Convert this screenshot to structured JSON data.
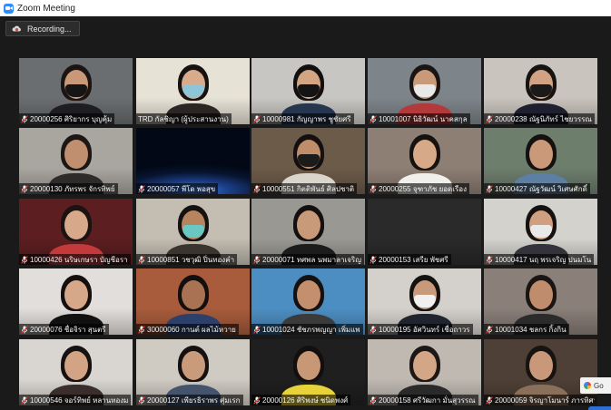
{
  "window": {
    "title": "Zoom Meeting",
    "icon": "zoom-icon"
  },
  "recording": {
    "label": "Recording...",
    "icon": "cloud-recording-icon"
  },
  "participants": [
    {
      "name": "20000256 ศิริยากร บุญคุ้ม",
      "muted": true,
      "active": false,
      "bg": "#6b6e70",
      "skin": "#c99878",
      "hair": "#1b1412",
      "shirt": "#1d1d22",
      "mask": "#151515"
    },
    {
      "name": "TRD กัลชิญา (ผู้ประสานงาน)",
      "muted": false,
      "active": true,
      "bg": "#e7e2d6",
      "skin": "#d8ab8c",
      "hair": "#171210",
      "shirt": "#2b2624",
      "mask": "#8fc5d8"
    },
    {
      "name": "10000981 กัญญาพร ชูชัยศรี",
      "muted": true,
      "active": false,
      "bg": "#c8c6c2",
      "skin": "#d3a582",
      "hair": "#120f0e",
      "shirt": "#27364f",
      "mask": "#141414"
    },
    {
      "name": "10001007 นิธิวัฒน์ นาคสกุล",
      "muted": true,
      "active": false,
      "bg": "#7e858a",
      "skin": "#c89a79",
      "hair": "#1a1512",
      "shirt": "#b33a3a",
      "mask": "#e8e8e8"
    },
    {
      "name": "20000238 ณัฐนิภัทร์ ไชยวรรณ",
      "muted": true,
      "active": false,
      "bg": "#c9c4bd",
      "skin": "#d1a283",
      "hair": "#171311",
      "shirt": "#1e2030",
      "mask": "#1a1a1a"
    },
    {
      "name": "20000130 ภัทรพร จักรทิพย์",
      "muted": true,
      "active": false,
      "bg": "#a9a6a0",
      "skin": "#c08f70",
      "hair": "#1c1614",
      "shirt": "#2f2b2a",
      "mask": ""
    },
    {
      "name": "20000057 พีโด พอสุข",
      "muted": true,
      "active": false,
      "bg": "#0b1836",
      "skin": "",
      "hair": "",
      "shirt": "",
      "mask": ""
    },
    {
      "name": "10000551 กิตติพันธ์ ศิลปชาติ",
      "muted": true,
      "active": false,
      "bg": "#6d5b49",
      "skin": "#bf8d6a",
      "hair": "#141010",
      "shirt": "#d9d4cc",
      "mask": "#1b1b1b"
    },
    {
      "name": "20000255 จุฑาภัช ยอดเรือง",
      "muted": true,
      "active": false,
      "bg": "#8e7f74",
      "skin": "#d7a988",
      "hair": "#161210",
      "shirt": "#f0efec",
      "mask": ""
    },
    {
      "name": "10000427 ณัฐวัฒน์ วิเศษศักดิ์",
      "muted": true,
      "active": false,
      "bg": "#6e7e6d",
      "skin": "#c99979",
      "hair": "#151110",
      "shirt": "#5d7fa3",
      "mask": ""
    },
    {
      "name": "10000426 นริษเกษรา บัญชีอรา",
      "muted": true,
      "active": false,
      "bg": "#5c1e20",
      "skin": "#d7a88a",
      "hair": "#1a1311",
      "shirt": "#c43a3a",
      "mask": ""
    },
    {
      "name": "10000851 วชวุฒิ ปิ่นทองคำ",
      "muted": true,
      "active": false,
      "bg": "#c3bdb2",
      "skin": "#b7845f",
      "hair": "#141110",
      "shirt": "#3a342e",
      "mask": "#69c9c2"
    },
    {
      "name": "20000071 ทศพล นพมาลาเจริญ",
      "muted": true,
      "active": false,
      "bg": "#9a9893",
      "skin": "#c99a7a",
      "hair": "#141010",
      "shirt": "#1c1c1c",
      "mask": ""
    },
    {
      "name": "20000153 เสรีย พัชศรี",
      "muted": true,
      "active": false,
      "bg": "#2a2a2a",
      "skin": "",
      "hair": "",
      "shirt": "",
      "mask": ""
    },
    {
      "name": "10000417 นฤ พรเจริญ ปนมโน",
      "muted": true,
      "active": false,
      "bg": "#d3d2cd",
      "skin": "#cf9f7f",
      "hair": "#151111",
      "shirt": "#34323a",
      "mask": "#e9e9e9"
    },
    {
      "name": "20000076 ชื่อจิรา สุนตรี",
      "muted": true,
      "active": false,
      "bg": "#e2dedb",
      "skin": "#d6a789",
      "hair": "#141010",
      "shirt": "#111111",
      "mask": ""
    },
    {
      "name": "30000060 กานต์ ผลไม้หวาย",
      "muted": true,
      "active": false,
      "bg": "#a85c3b",
      "skin": "#a97353",
      "hair": "#120f0e",
      "shirt": "#2d3f6b",
      "mask": ""
    },
    {
      "name": "10001024 ชัชภรพญญา เพิ่มแพ",
      "muted": true,
      "active": false,
      "bg": "#4d8ec2",
      "skin": "#c48f6d",
      "hair": "#151111",
      "shirt": "#3b3b3b",
      "mask": ""
    },
    {
      "name": "10000195 อัศวินทร์ เชื่อถาวร",
      "muted": true,
      "active": false,
      "bg": "#d4d1cc",
      "skin": "#c89a7b",
      "hair": "#141111",
      "shirt": "#20242e",
      "mask": "#f0f0f0"
    },
    {
      "name": "10001034 ชลกร กิ้งกิน",
      "muted": true,
      "active": false,
      "bg": "#8a7f79",
      "skin": "#c08d6c",
      "hair": "#1a1512",
      "shirt": "#2b2b2b",
      "mask": ""
    },
    {
      "name": "10000546 จอร์ทิพย์ หลานทองม",
      "muted": true,
      "active": false,
      "bg": "#d9d6d1",
      "skin": "#d2a384",
      "hair": "#161212",
      "shirt": "#3a2e2d",
      "mask": ""
    },
    {
      "name": "20000127 เพียรธิราพร ศุ่มเรก",
      "muted": true,
      "active": false,
      "bg": "#cfcac2",
      "skin": "#c99b7b",
      "hair": "#151111",
      "shirt": "#44546c",
      "mask": ""
    },
    {
      "name": "20000126 ศิริพงษ์ ชนิดพงศ์",
      "muted": true,
      "active": false,
      "bg": "#1f1f1f",
      "skin": "#c89775",
      "hair": "#120f0e",
      "shirt": "#e7d23a",
      "mask": ""
    },
    {
      "name": "20000158 ศรีวัฒกา มั่นสุวรรณ",
      "muted": true,
      "active": false,
      "bg": "#bfb9b1",
      "skin": "#d3a688",
      "hair": "#1d1715",
      "shirt": "#2a2a2a",
      "mask": ""
    },
    {
      "name": "20000059 จิรญาโมนาร์ ภารทิศา",
      "muted": true,
      "active": false,
      "bg": "#4e4036",
      "skin": "#c9987a",
      "hair": "#171311",
      "shirt": "#8a6f5a",
      "mask": ""
    }
  ],
  "side_popup": {
    "text": "Go",
    "icon": "chrome-icon"
  }
}
